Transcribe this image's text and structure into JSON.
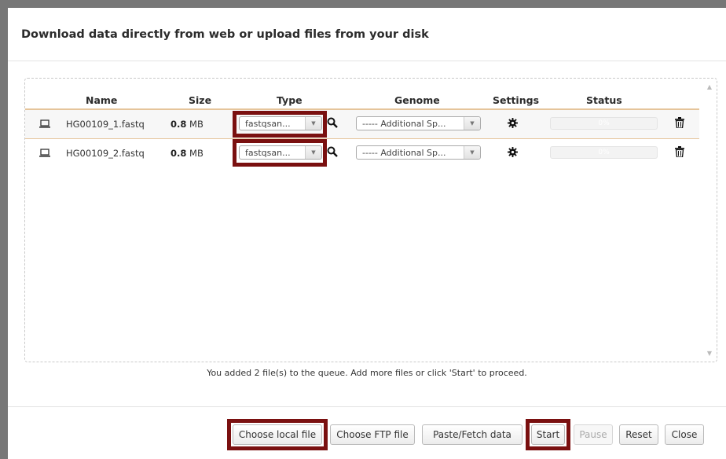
{
  "dialog": {
    "title": "Download data directly from web or upload files from your disk"
  },
  "columns": {
    "name": "Name",
    "size": "Size",
    "type": "Type",
    "genome": "Genome",
    "settings": "Settings",
    "status": "Status"
  },
  "rows": [
    {
      "name": "HG00109_1.fastq",
      "size_value": "0.8",
      "size_unit": "MB",
      "type": "fastqsan...",
      "genome": "----- Additional Sp...",
      "progress_label": "0%",
      "progress": 0
    },
    {
      "name": "HG00109_2.fastq",
      "size_value": "0.8",
      "size_unit": "MB",
      "type": "fastqsan...",
      "genome": "----- Additional Sp...",
      "progress_label": "0%",
      "progress": 0
    }
  ],
  "queue_message": "You added 2 file(s) to the queue. Add more files or click 'Start' to proceed.",
  "buttons": {
    "choose_local": "Choose local file",
    "choose_ftp": "Choose FTP file",
    "paste_fetch": "Paste/Fetch data",
    "start": "Start",
    "pause": "Pause",
    "reset": "Reset",
    "close": "Close"
  },
  "icons": {
    "file": "laptop-icon",
    "search": "search-icon",
    "settings": "gear-icon",
    "delete": "trash-icon"
  },
  "colors": {
    "highlight": "#7a1010",
    "header_rule": "#e5c49a"
  }
}
